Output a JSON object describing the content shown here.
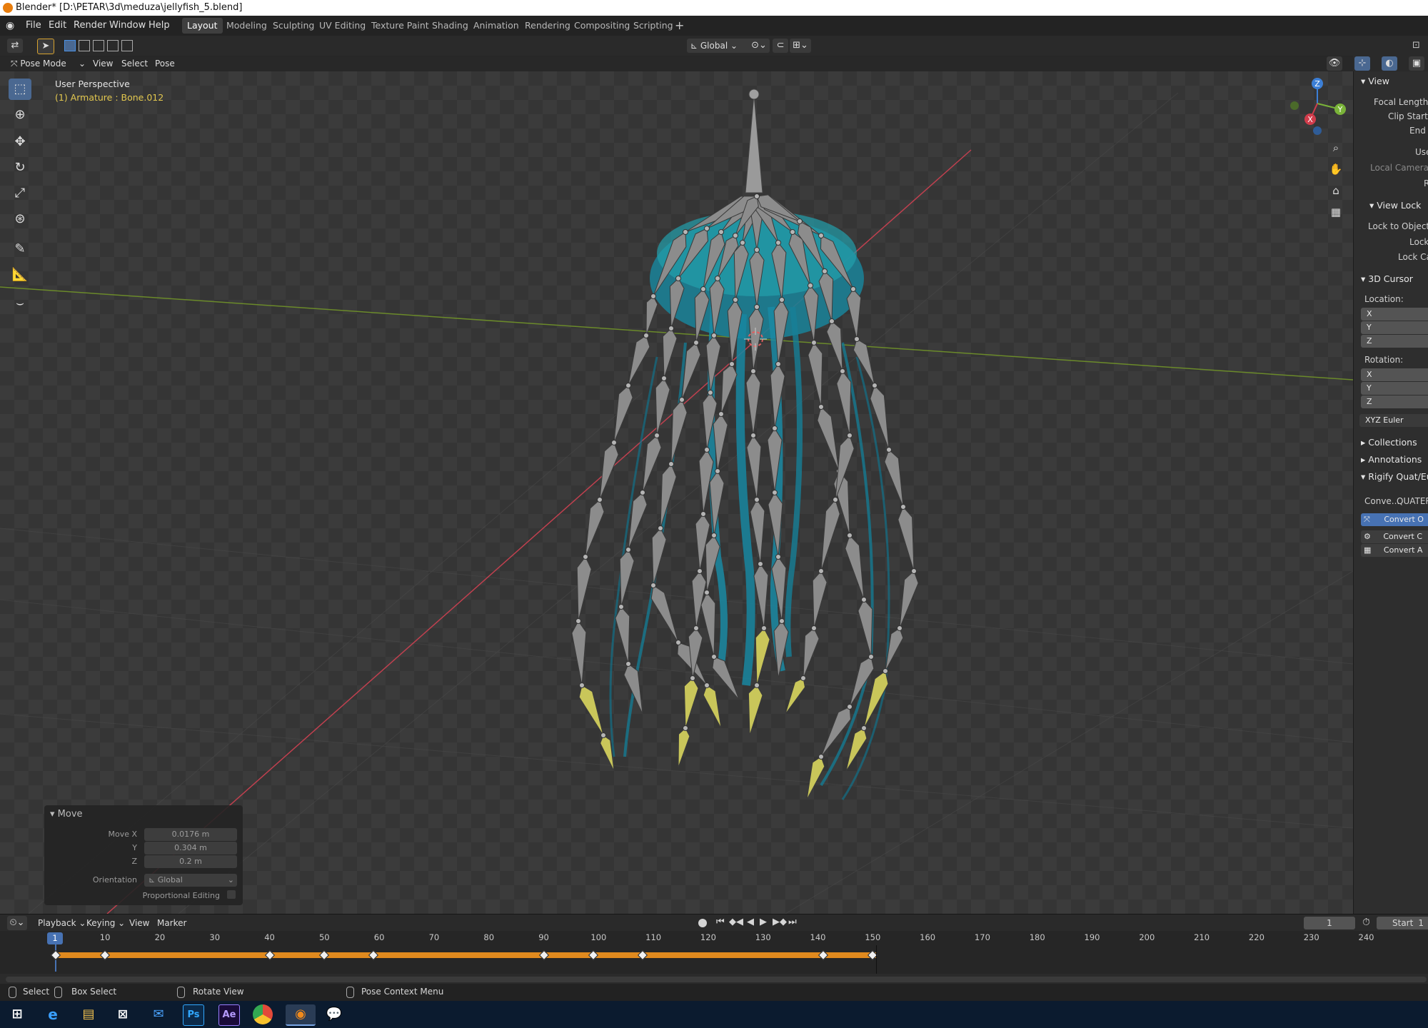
{
  "title_bar": {
    "title": "Blender* [D:\\PETAR\\3d\\meduza\\jellyfish_5.blend]"
  },
  "menu": [
    "File",
    "Edit",
    "Render",
    "Window",
    "Help"
  ],
  "workspaces": [
    "Layout",
    "Modeling",
    "Sculpting",
    "UV Editing",
    "Texture Paint",
    "Shading",
    "Animation",
    "Rendering",
    "Compositing",
    "Scripting"
  ],
  "active_workspace": "Layout",
  "tool_header": {
    "orientation": "Global"
  },
  "view_header": {
    "mode": "Pose Mode",
    "menus": [
      "View",
      "Select",
      "Pose"
    ]
  },
  "viewport": {
    "perspective": "User Perspective",
    "object_info": "(1) Armature : Bone.012",
    "axis_labels": {
      "x": "X",
      "y": "Y",
      "z": "Z"
    },
    "colors": {
      "x_axis": "#c0404f",
      "y_axis": "#6b8a2a",
      "bone": "#8c8c8c",
      "bone_selected": "#c9c65a",
      "jellyfish": "#1f8fa6"
    }
  },
  "sidebar": {
    "view_header": "View",
    "focal_length": "Focal Length",
    "clip_start": "Clip Start",
    "end": "End",
    "use_local": "Use L",
    "local_camera": "Local Camera",
    "r_label": "R",
    "view_lock_header": "View Lock",
    "lock_to_object": "Lock to Object",
    "lock": "Lock",
    "lock_camera": "Lock Ca",
    "cursor_header": "3D Cursor",
    "location_label": "Location:",
    "rotation_label": "Rotation:",
    "loc_x": "X",
    "loc_y": "Y",
    "loc_z": "Z",
    "rot_x": "X",
    "rot_y": "Y",
    "rot_z": "Z",
    "rotation_mode": "XYZ Euler",
    "collections": "Collections",
    "annotations": "Annotations",
    "rigify_header": "Rigify Quat/Eul",
    "convert_label": "Conve...",
    "convert_value": "QUATERN",
    "convert_buttons": [
      "Convert O",
      "Convert C",
      "Convert A"
    ]
  },
  "operator_panel": {
    "title": "Move",
    "move_x_label": "Move X",
    "move_x": "0.0176 m",
    "y_label": "Y",
    "y": "0.304 m",
    "z_label": "Z",
    "z": "0.2 m",
    "orientation_label": "Orientation",
    "orientation": "Global",
    "proportional_label": "Proportional Editing"
  },
  "timeline": {
    "menus": [
      "Playback",
      "Keying",
      "View",
      "Marker"
    ],
    "current_frame": "1",
    "frame_field": "1",
    "start_label": "Start",
    "start_value": "1",
    "frame_labels": [
      "10",
      "20",
      "30",
      "40",
      "50",
      "60",
      "70",
      "80",
      "90",
      "100",
      "110",
      "120",
      "130",
      "140",
      "150",
      "160",
      "170",
      "180",
      "190",
      "200",
      "210",
      "220",
      "230",
      "240"
    ],
    "keyframes": [
      1,
      10,
      40,
      50,
      59,
      90,
      99,
      108,
      141,
      150
    ],
    "range_end": 150
  },
  "status_bar": {
    "items": [
      "Select",
      "Box Select",
      "Rotate View",
      "Pose Context Menu"
    ]
  },
  "taskbar": {
    "apps": [
      "windows-start",
      "edge",
      "file-explorer",
      "store",
      "mail",
      "photoshop",
      "after-effects",
      "chrome",
      "blender",
      "chat"
    ],
    "labels": {
      "ps": "Ps",
      "ae": "Ae"
    }
  }
}
